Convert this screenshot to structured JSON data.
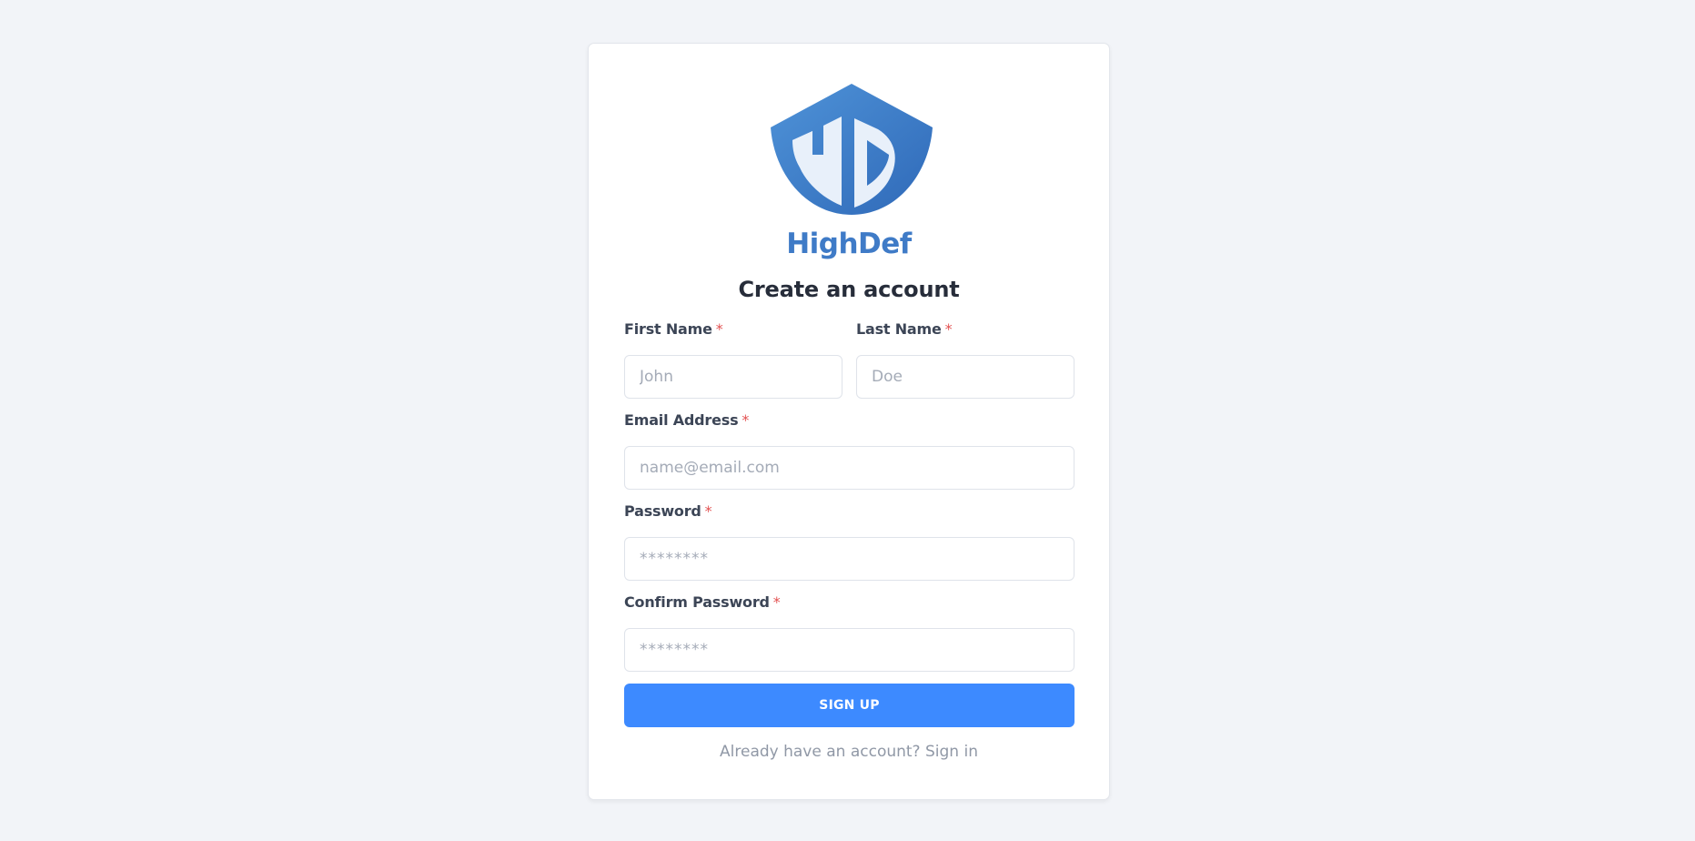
{
  "brand": {
    "name": "HighDef",
    "logo_letters": "HD",
    "logo_icon": "shield-icon"
  },
  "colors": {
    "background": "#f2f4f8",
    "brand": "#3f7bc7",
    "primary": "#3d8aff",
    "required": "#e35151"
  },
  "form": {
    "title": "Create an account",
    "required_marker": "*",
    "first_name": {
      "label": "First Name",
      "placeholder": "John"
    },
    "last_name": {
      "label": "Last Name",
      "placeholder": "Doe"
    },
    "email": {
      "label": "Email Address",
      "placeholder": "name@email.com"
    },
    "password": {
      "label": "Password",
      "placeholder": "********"
    },
    "confirm_password": {
      "label": "Confirm Password",
      "placeholder": "********"
    },
    "submit_label": "SIGN UP",
    "footer": {
      "prompt": "Already have an account?",
      "link": "Sign in"
    }
  }
}
